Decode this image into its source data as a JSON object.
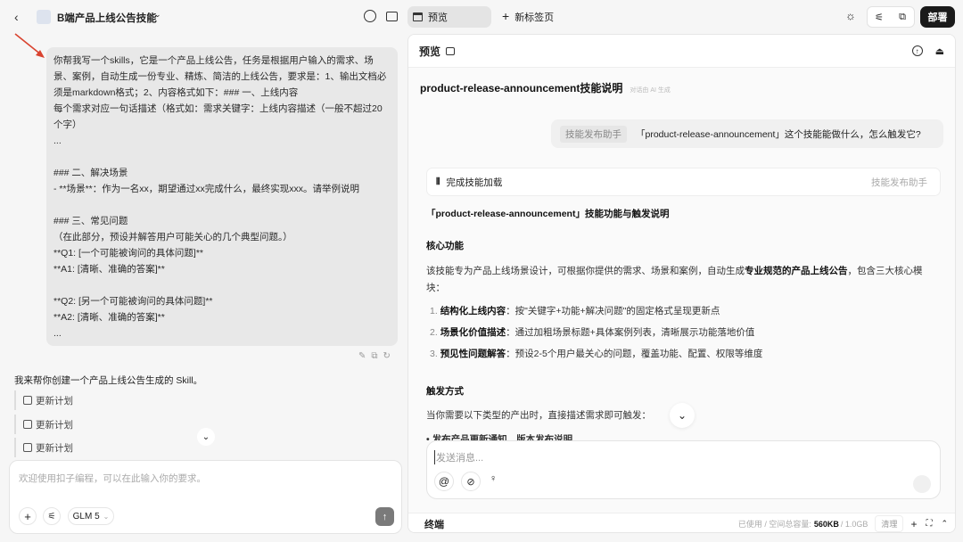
{
  "header": {
    "title": "B端产品上线公告技能",
    "tab_preview": "预览",
    "tab_new": "新标签页",
    "deploy": "部署"
  },
  "left": {
    "user_message": "你帮我写一个skills，它是一个产品上线公告，任务是根据用户输入的需求、场景、案例，自动生成一份专业、精炼、简洁的上线公告，要求是：1、输出文档必须是markdown格式；2、内容格式如下：### 一、上线内容\n每个需求对应一句话描述（格式如：需求关键字：上线内容描述（一般不超过20个字）\n...\n\n### 二、解决场景\n- **场景**：作为一名xx，期望通过xx完成什么，最终实现xxx。请举例说明\n\n### 三、常见问题\n（在此部分，预设并解答用户可能关心的几个典型问题。）\n**Q1: [一个可能被询问的具体问题]**\n**A1: [清晰、准确的答案]**\n\n**Q2: [另一个可能被询问的具体问题]**\n**A2: [清晰、准确的答案]**\n...",
    "assistant_message": "我来帮你创建一个产品上线公告生成的 Skill。",
    "plans": [
      "更新计划",
      "更新计划",
      "更新计划"
    ],
    "input_placeholder": "欢迎使用扣子编程，可以在此输入你的要求。",
    "model": "GLM 5"
  },
  "preview": {
    "title": "预览",
    "doc_title": "product-release-announcement技能说明",
    "ai_note": "对话由 AI 生成",
    "query_tag": "技能发布助手",
    "query": "「product-release-announcement」这个技能能做什么，怎么触发它?",
    "loaded": "完成技能加载",
    "loaded_tag": "技能发布助手",
    "answer_title": "「product-release-announcement」技能功能与触发说明",
    "core_heading": "核心功能",
    "core_intro_a": "该技能专为产品上线场景设计，可根据你提供的需求、场景和案例，自动生成",
    "core_intro_b": "专业规范的产品上线公告",
    "core_intro_c": "，包含三大核心模块：",
    "items": [
      {
        "num": "1.",
        "bold": "结构化上线内容",
        "text": "：按\"关键字+功能+解决问题\"的固定格式呈现更新点"
      },
      {
        "num": "2.",
        "bold": "场景化价值描述",
        "text": "：通过加粗场景标题+具体案例列表，清晰展示功能落地价值"
      },
      {
        "num": "3.",
        "bold": "预见性问题解答",
        "text": "：预设2-5个用户最关心的问题，覆盖功能、配置、权限等维度"
      }
    ],
    "trigger_heading": "触发方式",
    "trigger_intro": "当你需要以下类型的产出时，直接描述需求即可触发：",
    "trigger_partial": "• 发布产品更新通知、版本发布说明",
    "input_placeholder": "发送消息...",
    "terminal": "终端",
    "usage_label": "已使用 / 空间总容量:",
    "usage_used": "560KB",
    "usage_total": "/ 1.0GB",
    "clean": "清理"
  }
}
